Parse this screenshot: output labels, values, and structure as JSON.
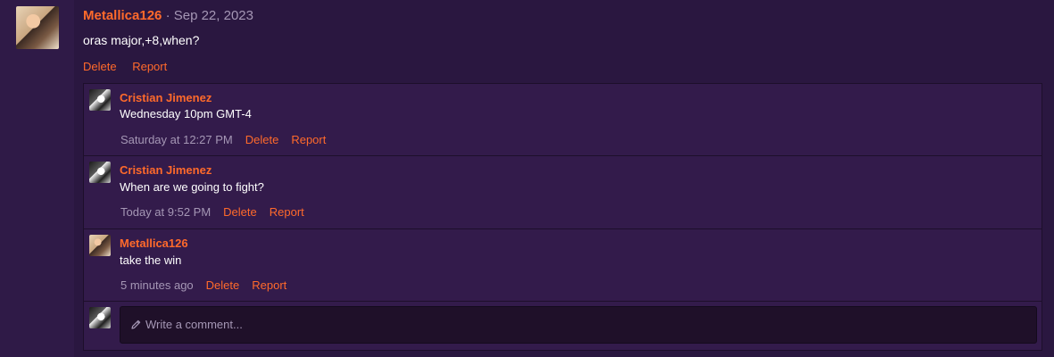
{
  "post": {
    "author": "Metallica126",
    "date_sep": "·",
    "date": "Sep 22, 2023",
    "body": "oras major,+8,when?",
    "actions": {
      "delete": "Delete",
      "report": "Report"
    }
  },
  "comments": [
    {
      "author": "Cristian Jimenez",
      "text": "Wednesday 10pm GMT-4",
      "time": "Saturday at 12:27 PM",
      "delete": "Delete",
      "report": "Report",
      "avatar": "bw-anime-avatar"
    },
    {
      "author": "Cristian Jimenez",
      "text": "When are we going to fight?",
      "time": "Today at 9:52 PM",
      "delete": "Delete",
      "report": "Report",
      "avatar": "bw-anime-avatar"
    },
    {
      "author": "Metallica126",
      "text": "take the win",
      "time": "5 minutes ago",
      "delete": "Delete",
      "report": "Report",
      "avatar": "anime-girl-avatar"
    }
  ],
  "composer": {
    "placeholder": "Write a comment...",
    "icon": "pencil-icon"
  },
  "colors": {
    "accent": "#ff6a2b",
    "background": "#2a1740",
    "panel": "#331b4b",
    "muted_text": "#a597b5"
  }
}
